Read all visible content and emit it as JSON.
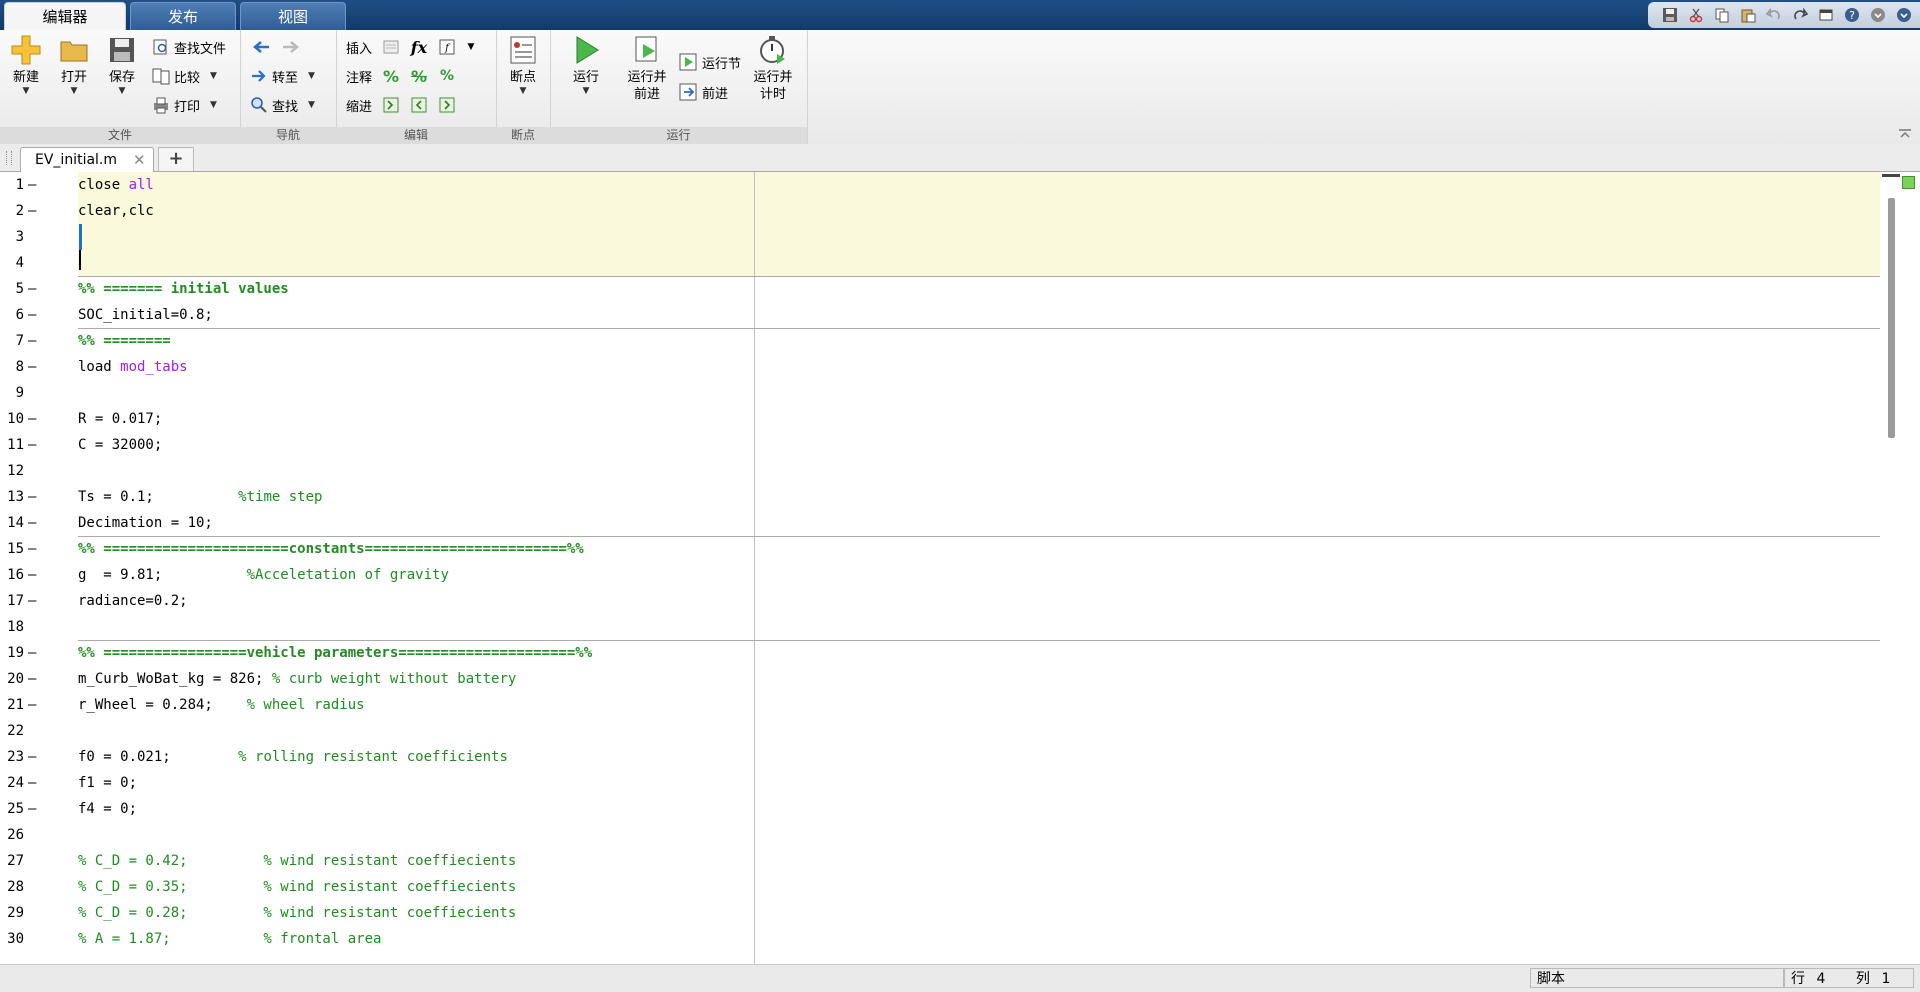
{
  "ribbon_tabs": [
    "编辑器",
    "发布",
    "视图"
  ],
  "ribbon": {
    "file": {
      "group": "文件",
      "new": "新建",
      "open": "打开",
      "save": "保存",
      "find_files": "查找文件",
      "compare": "比较",
      "print": "打印"
    },
    "navigate": {
      "group": "导航",
      "goto": "转至",
      "find": "查找"
    },
    "edit": {
      "group": "编辑",
      "insert": "插入",
      "comment": "注释",
      "indent": "缩进",
      "fx": "fx"
    },
    "breakpoints": {
      "group": "断点",
      "label": "断点"
    },
    "run": {
      "group": "运行",
      "run": "运行",
      "run_advance": "运行并前进",
      "run_section": "运行节",
      "advance": "前进",
      "run_time": "运行并计时"
    }
  },
  "editor_tab": {
    "name": "EV_initial.m",
    "close": "✕",
    "new": "+"
  },
  "code_lines": [
    {
      "n": "1",
      "d": "—",
      "parts": [
        {
          "t": "close ",
          "c": ""
        },
        {
          "t": "all",
          "c": "str"
        }
      ]
    },
    {
      "n": "2",
      "d": "—",
      "parts": [
        {
          "t": "clear,clc",
          "c": ""
        }
      ]
    },
    {
      "n": "3",
      "d": "",
      "parts": []
    },
    {
      "n": "4",
      "d": "",
      "parts": []
    },
    {
      "n": "5",
      "d": "—",
      "parts": [
        {
          "t": "%% ======= initial values",
          "c": "cmb"
        }
      ]
    },
    {
      "n": "6",
      "d": "—",
      "parts": [
        {
          "t": "SOC_initial=0.8;",
          "c": ""
        }
      ]
    },
    {
      "n": "7",
      "d": "—",
      "parts": [
        {
          "t": "%% ========",
          "c": "cmb"
        }
      ]
    },
    {
      "n": "8",
      "d": "—",
      "parts": [
        {
          "t": "load ",
          "c": ""
        },
        {
          "t": "mod_tabs",
          "c": "str"
        }
      ]
    },
    {
      "n": "9",
      "d": "",
      "parts": []
    },
    {
      "n": "10",
      "d": "—",
      "parts": [
        {
          "t": "R = 0.017;",
          "c": ""
        }
      ]
    },
    {
      "n": "11",
      "d": "—",
      "parts": [
        {
          "t": "C = 32000;",
          "c": ""
        }
      ]
    },
    {
      "n": "12",
      "d": "",
      "parts": []
    },
    {
      "n": "13",
      "d": "—",
      "parts": [
        {
          "t": "Ts = 0.1;          ",
          "c": ""
        },
        {
          "t": "%time step",
          "c": "cm"
        }
      ]
    },
    {
      "n": "14",
      "d": "—",
      "parts": [
        {
          "t": "Decimation = 10;",
          "c": ""
        }
      ]
    },
    {
      "n": "15",
      "d": "—",
      "parts": [
        {
          "t": "%% ======================constants========================%%",
          "c": "cmb"
        }
      ]
    },
    {
      "n": "16",
      "d": "—",
      "parts": [
        {
          "t": "g  = 9.81;          ",
          "c": ""
        },
        {
          "t": "%Acceletation of gravity",
          "c": "cm"
        }
      ]
    },
    {
      "n": "17",
      "d": "—",
      "parts": [
        {
          "t": "radiance=0.2;",
          "c": ""
        }
      ]
    },
    {
      "n": "18",
      "d": "",
      "parts": []
    },
    {
      "n": "19",
      "d": "—",
      "parts": [
        {
          "t": "%% =================vehicle parameters=====================%%",
          "c": "cmb"
        }
      ]
    },
    {
      "n": "20",
      "d": "—",
      "parts": [
        {
          "t": "m_Curb_WoBat_kg = 826; ",
          "c": ""
        },
        {
          "t": "% curb weight without battery",
          "c": "cm"
        }
      ]
    },
    {
      "n": "21",
      "d": "—",
      "parts": [
        {
          "t": "r_Wheel = 0.284;    ",
          "c": ""
        },
        {
          "t": "% wheel radius",
          "c": "cm"
        }
      ]
    },
    {
      "n": "22",
      "d": "",
      "parts": []
    },
    {
      "n": "23",
      "d": "—",
      "parts": [
        {
          "t": "f0 = 0.021;        ",
          "c": ""
        },
        {
          "t": "% rolling resistant coefficients",
          "c": "cm"
        }
      ]
    },
    {
      "n": "24",
      "d": "—",
      "parts": [
        {
          "t": "f1 = 0;",
          "c": ""
        }
      ]
    },
    {
      "n": "25",
      "d": "—",
      "parts": [
        {
          "t": "f4 = 0;",
          "c": ""
        }
      ]
    },
    {
      "n": "26",
      "d": "",
      "parts": []
    },
    {
      "n": "27",
      "d": "",
      "parts": [
        {
          "t": "% C_D = 0.42;         % wind resistant coeffiecients",
          "c": "cm"
        }
      ]
    },
    {
      "n": "28",
      "d": "",
      "parts": [
        {
          "t": "% C_D = 0.35;         % wind resistant coeffiecients",
          "c": "cm"
        }
      ]
    },
    {
      "n": "29",
      "d": "",
      "parts": [
        {
          "t": "% C_D = 0.28;         % wind resistant coeffiecients",
          "c": "cm"
        }
      ]
    },
    {
      "n": "30",
      "d": "",
      "parts": [
        {
          "t": "% A = 1.87;           % frontal area",
          "c": "cm"
        }
      ]
    }
  ],
  "statusbar": {
    "mode": "脚本",
    "row_label": "行",
    "row": "4",
    "col_label": "列",
    "col": "1"
  }
}
